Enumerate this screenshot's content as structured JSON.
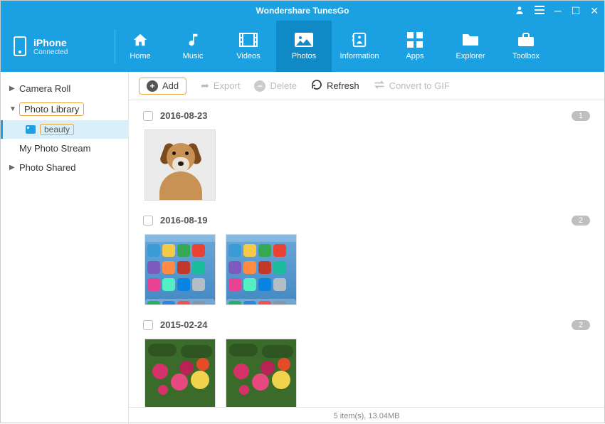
{
  "title": "Wondershare TunesGo",
  "device": {
    "name": "iPhone",
    "status": "Connected"
  },
  "tabs": {
    "home": "Home",
    "music": "Music",
    "videos": "Videos",
    "photos": "Photos",
    "information": "Information",
    "apps": "Apps",
    "explorer": "Explorer",
    "toolbox": "Toolbox"
  },
  "sidebar": {
    "camera_roll": "Camera Roll",
    "photo_library": "Photo Library",
    "beauty": "beauty",
    "my_photo_stream": "My Photo Stream",
    "photo_shared": "Photo Shared"
  },
  "toolbar": {
    "add": "Add",
    "export": "Export",
    "delete": "Delete",
    "refresh": "Refresh",
    "convert": "Convert to GIF"
  },
  "groups": [
    {
      "date": "2016-08-23",
      "count": "1"
    },
    {
      "date": "2016-08-19",
      "count": "2"
    },
    {
      "date": "2015-02-24",
      "count": "2"
    }
  ],
  "status": "5 item(s), 13.04MB"
}
